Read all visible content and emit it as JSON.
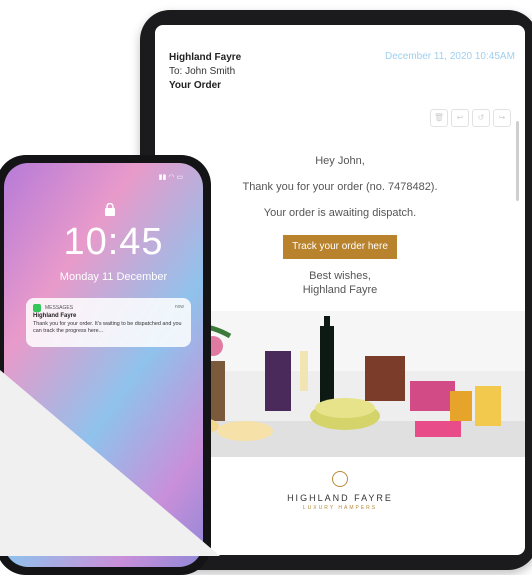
{
  "email": {
    "sender": "Highland Fayre",
    "to": "To: John Smith",
    "subject": "Your Order",
    "date": "December 11, 2020 10:45AM",
    "greeting": "Hey John,",
    "thanks": "Thank you for your order (no. 7478482).",
    "status": "Your order is awaiting dispatch.",
    "button": "Track your order here",
    "signoff_1": "Best wishes,",
    "signoff_2": "Highland Fayre",
    "action_icons": [
      "trash-icon",
      "reply-icon",
      "reply-all-icon",
      "forward-icon"
    ]
  },
  "brand": {
    "name": "HIGHLAND FAYRE",
    "tagline": "LUXURY HAMPERS"
  },
  "phone": {
    "time": "10:45",
    "date": "Monday 11 December",
    "notification": {
      "app": "MESSAGES",
      "when": "now",
      "title": "Highland Fayre",
      "text": "Thank you for your order. It’s waiting to be dispatched and you can track the progress here..."
    }
  },
  "colors": {
    "button": "#b9822d",
    "date_text": "#9fd0ef",
    "device_frame": "#1b1b1d"
  }
}
